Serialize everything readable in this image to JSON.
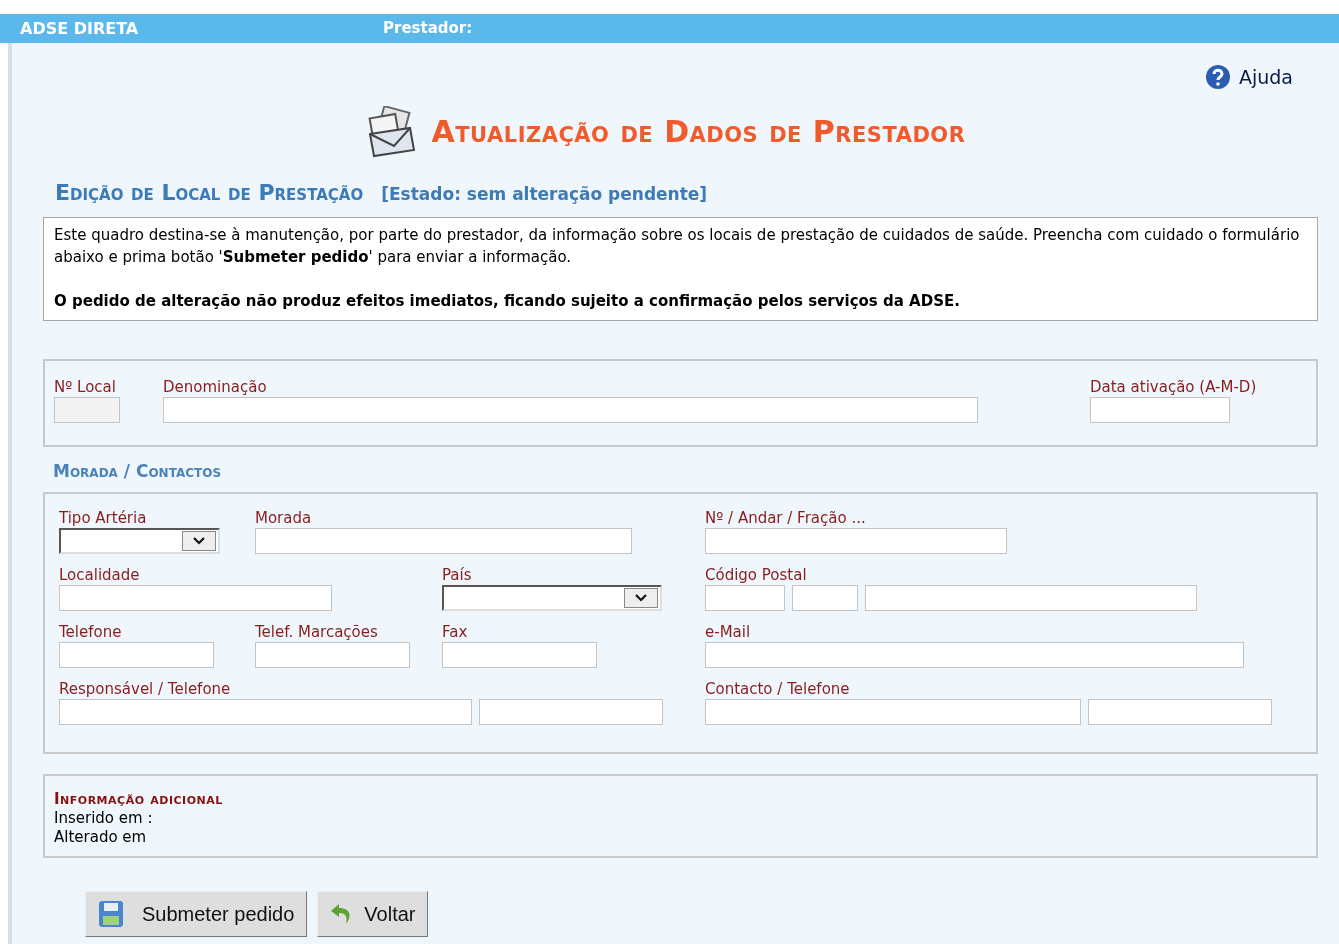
{
  "header": {
    "app_name": "ADSE DIRETA",
    "provider_label": "Prestador:"
  },
  "help_link": "Ajuda",
  "page_title": "Atualização de Dados de Prestador",
  "section_title": "Edição de Local de Prestação",
  "status": "[Estado: sem alteração pendente]",
  "notice": {
    "text": "Este quadro destina-se à manutenção, por parte do prestador, da informação sobre os locais de prestação de cuidados de saúde. Preencha com cuidado o formulário abaixo e prima botão '**Submeter pedido**' para enviar a informação.",
    "warning": "O pedido de alteração não produz efeitos imediatos, ficando sujeito a confirmação pelos serviços da ADSE."
  },
  "location_fields": [
    {
      "label": "Nº Local",
      "disabled": true
    },
    {
      "label": "Denominação",
      "disabled": false
    },
    {
      "label": "Data ativação (A-M-D)",
      "disabled": false
    }
  ],
  "address_title": "Morada / Contactos",
  "address_rows": [
    [
      {
        "label": "Tipo Artéria",
        "kind": "select"
      },
      {
        "label": "Morada",
        "kind": "input"
      },
      {
        "label": "Nº / Andar / Fração ...",
        "kind": "input"
      }
    ],
    [
      {
        "label": "Localidade",
        "kind": "input"
      },
      {
        "label": "País",
        "kind": "select"
      },
      {
        "label": "Código Postal",
        "kind": "postal"
      }
    ],
    [
      {
        "label": "Telefone",
        "kind": "input"
      },
      {
        "label": "Telef. Marcações",
        "kind": "input"
      },
      {
        "label": "Fax",
        "kind": "input"
      },
      {
        "label": "e-Mail",
        "kind": "input"
      }
    ],
    [
      {
        "label": "Responsável / Telefone",
        "kind": "pair"
      },
      {
        "label": "Contacto / Telefone",
        "kind": "pair"
      }
    ]
  ],
  "additional_info": {
    "title": "Informação adicional",
    "lines": [
      "Inserido em :",
      "Alterado em"
    ]
  },
  "buttons": [
    {
      "label": "Submeter pedido",
      "kind": "save"
    },
    {
      "label": "Voltar",
      "kind": "back"
    }
  ]
}
